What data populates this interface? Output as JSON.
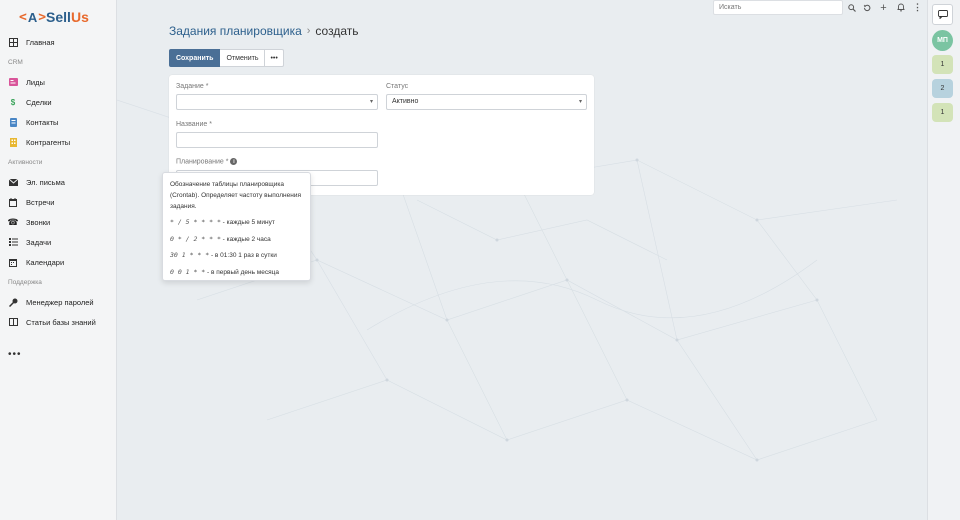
{
  "logo": {
    "open": "<",
    "mark": "A",
    "close": ">",
    "sell": "Sell",
    "us": "Us"
  },
  "sidebar": {
    "items": [
      {
        "key": "home",
        "label": "Главная",
        "icon": "grid-icon"
      },
      {
        "key": "group-crm",
        "label": "CRM",
        "group": true
      },
      {
        "key": "leads",
        "label": "Лиды",
        "icon": "id-card-icon"
      },
      {
        "key": "deals",
        "label": "Сделки",
        "icon": "dollar-icon"
      },
      {
        "key": "contacts",
        "label": "Контакты",
        "icon": "address-book-icon"
      },
      {
        "key": "counterparties",
        "label": "Контрагенты",
        "icon": "building-icon"
      },
      {
        "key": "group-activities",
        "label": "Активности",
        "group": true
      },
      {
        "key": "emails",
        "label": "Эл. письма",
        "icon": "envelope-icon"
      },
      {
        "key": "meetings",
        "label": "Встречи",
        "icon": "calendar-icon"
      },
      {
        "key": "calls",
        "label": "Звонки",
        "icon": "phone-icon"
      },
      {
        "key": "tasks",
        "label": "Задачи",
        "icon": "list-icon"
      },
      {
        "key": "calendars",
        "label": "Календари",
        "icon": "calendar-icon"
      },
      {
        "key": "group-support",
        "label": "Поддержка",
        "group": true
      },
      {
        "key": "password-manager",
        "label": "Менеджер паролей",
        "icon": "key-icon"
      },
      {
        "key": "kb-articles",
        "label": "Статьи базы знаний",
        "icon": "book-icon"
      }
    ],
    "more": "•••"
  },
  "topbar": {
    "search_placeholder": "Искать"
  },
  "rail": {
    "avatar_initials": "МП",
    "badges": [
      "1",
      "2",
      "1"
    ]
  },
  "breadcrumb": {
    "parent": "Задания планировщика",
    "sep": "›",
    "current": "создать"
  },
  "toolbar": {
    "save_label": "Сохранить",
    "cancel_label": "Отменить",
    "more_label": "•••"
  },
  "form": {
    "job_label": "Задание *",
    "job_value": "",
    "status_label": "Статус",
    "status_value": "Активно",
    "name_label": "Название *",
    "name_value": "",
    "schedule_label": "Планирование *",
    "schedule_value": ""
  },
  "tooltip": {
    "description": "Обозначение таблицы планировщика (Crontab). Определяет частоту выполнения задания.",
    "examples": [
      {
        "code": "* / 5 * * * *",
        "text": " - каждые 5 минут"
      },
      {
        "code": "0 * / 2 * * *",
        "text": " - каждые 2 часа"
      },
      {
        "code": "30 1 * * *",
        "text": " - в 01:30 1 раз в сутки"
      },
      {
        "code": "0 0 1 * *",
        "text": " - в первый день месяца"
      }
    ]
  },
  "colors": {
    "brand_blue": "#2c5f8c",
    "brand_orange": "#e8692c",
    "primary_button": "#4a6f96"
  }
}
